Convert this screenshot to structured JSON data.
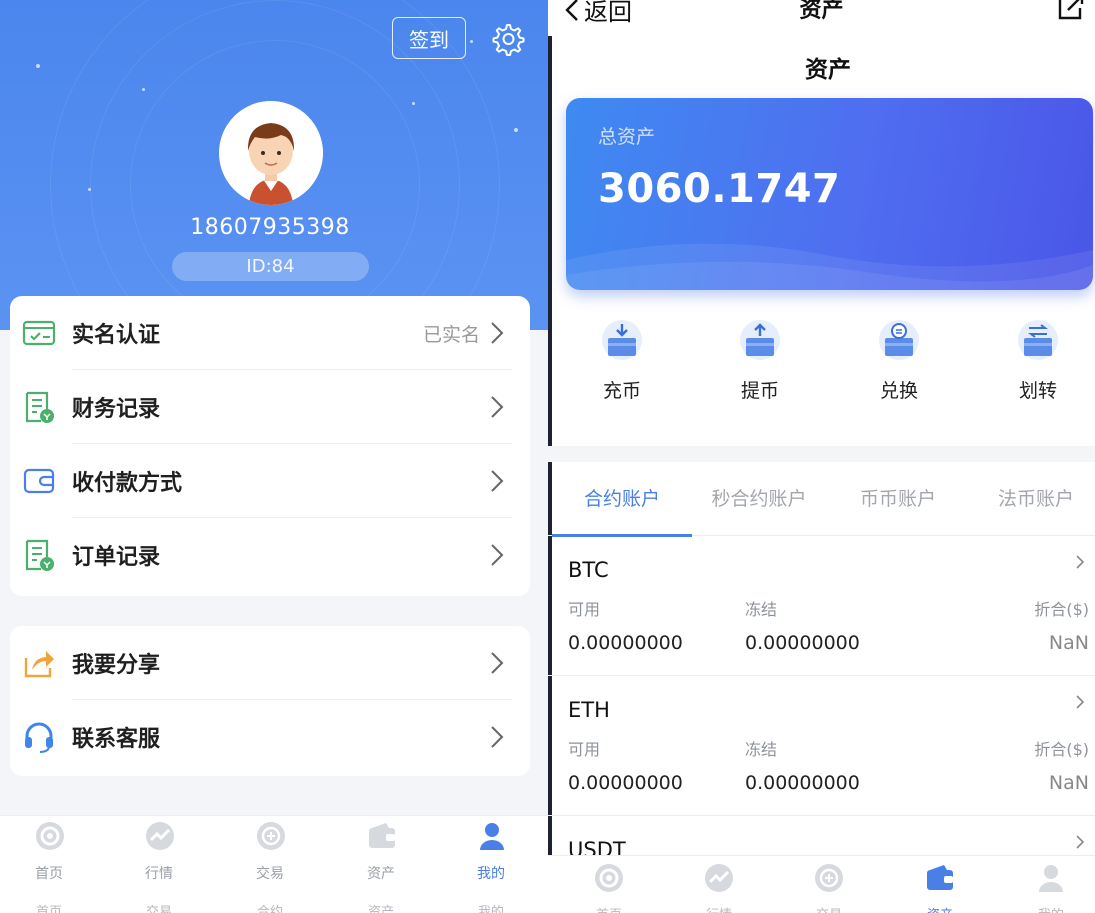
{
  "left": {
    "signin_label": "签到",
    "phone": "18607935398",
    "id_label": "ID:84",
    "menu_group1": [
      {
        "label": "实名认证",
        "right": "已实名",
        "icon": "id-card-icon"
      },
      {
        "label": "财务记录",
        "right": "",
        "icon": "finance-record-icon"
      },
      {
        "label": "收付款方式",
        "right": "",
        "icon": "wallet-icon"
      },
      {
        "label": "订单记录",
        "right": "",
        "icon": "order-record-icon"
      }
    ],
    "menu_group2": [
      {
        "label": "我要分享",
        "right": "",
        "icon": "share-icon"
      },
      {
        "label": "联系客服",
        "right": "",
        "icon": "headset-icon"
      }
    ],
    "tabbar": [
      {
        "label": "首页",
        "label2": "首页",
        "icon": "home-icon",
        "active": false
      },
      {
        "label": "行情",
        "label2": "交易",
        "icon": "market-icon",
        "active": false
      },
      {
        "label": "交易",
        "label2": "合约",
        "icon": "trade-icon",
        "active": false
      },
      {
        "label": "资产",
        "label2": "资产",
        "icon": "asset-icon",
        "active": false
      },
      {
        "label": "我的",
        "label2": "我的",
        "icon": "user-icon",
        "active": true
      }
    ],
    "colors": {
      "hero": "#4b86ee",
      "accent": "#4a7fe6",
      "icon_green": "#4bb06b"
    }
  },
  "right": {
    "nav": {
      "back_label": "返回",
      "top_title": "资产"
    },
    "page_title": "资产",
    "total_label": "总资产",
    "total_value": "3060.1747",
    "actions": [
      {
        "label": "充币",
        "icon": "deposit-icon"
      },
      {
        "label": "提币",
        "icon": "withdraw-icon"
      },
      {
        "label": "兑换",
        "icon": "exchange-icon"
      },
      {
        "label": "划转",
        "icon": "transfer-icon"
      }
    ],
    "account_tabs": [
      "合约账户",
      "秒合约账户",
      "币币账户",
      "法币账户"
    ],
    "active_tab": "合约账户",
    "coins": [
      {
        "name": "BTC",
        "available_label": "可用",
        "frozen_label": "冻结",
        "converted_label": "折合($)",
        "available": "0.00000000",
        "frozen": "0.00000000",
        "converted": "NaN"
      },
      {
        "name": "ETH",
        "available_label": "可用",
        "frozen_label": "冻结",
        "converted_label": "折合($)",
        "available": "0.00000000",
        "frozen": "0.00000000",
        "converted": "NaN"
      },
      {
        "name": "USDT"
      }
    ],
    "tabbar": [
      {
        "label": "首页",
        "icon": "home-icon",
        "active": false
      },
      {
        "label": "行情",
        "icon": "market-icon",
        "active": false
      },
      {
        "label": "交易",
        "icon": "trade-icon",
        "active": false
      },
      {
        "label": "资产",
        "icon": "wallet-icon",
        "active": true
      },
      {
        "label": "我的",
        "icon": "user-icon",
        "active": false
      }
    ]
  }
}
